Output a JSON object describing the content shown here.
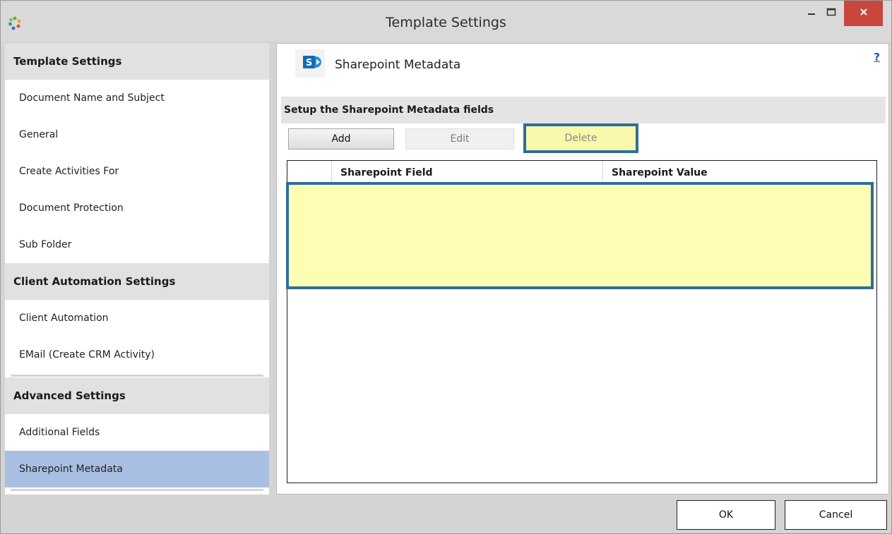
{
  "window": {
    "title": "Template Settings",
    "icons": {
      "app": "app-ring-icon",
      "minimize": "minimize-icon",
      "maximize": "maximize-icon",
      "close": "close-icon"
    }
  },
  "sidebar": {
    "groups": [
      {
        "header": "Template Settings",
        "items": [
          "Document Name and Subject",
          "General",
          "Create Activities For",
          "Document Protection",
          "Sub Folder"
        ]
      },
      {
        "header": "Client Automation Settings",
        "items": [
          "Client Automation",
          "EMail (Create CRM Activity)"
        ]
      },
      {
        "header": "Advanced Settings",
        "items": [
          "Additional Fields",
          "Sharepoint Metadata"
        ]
      }
    ],
    "selected_item": "Sharepoint Metadata",
    "selected_color": "#a9bfe2"
  },
  "panel": {
    "title": "Sharepoint Metadata",
    "logo_icon": "sharepoint-logo-icon",
    "help": "?",
    "section_label": "Setup the Sharepoint Metadata fields",
    "buttons": {
      "add": "Add",
      "edit": "Edit",
      "delete": "Delete"
    },
    "grid": {
      "columns": [
        "Sharepoint Field",
        "Sharepoint Value"
      ],
      "rows": []
    }
  },
  "footer": {
    "ok": "OK",
    "cancel": "Cancel"
  },
  "colors": {
    "highlight_fill": "#fdfdb3",
    "highlight_border": "#2e6e9e",
    "close_button": "#c9463d"
  }
}
